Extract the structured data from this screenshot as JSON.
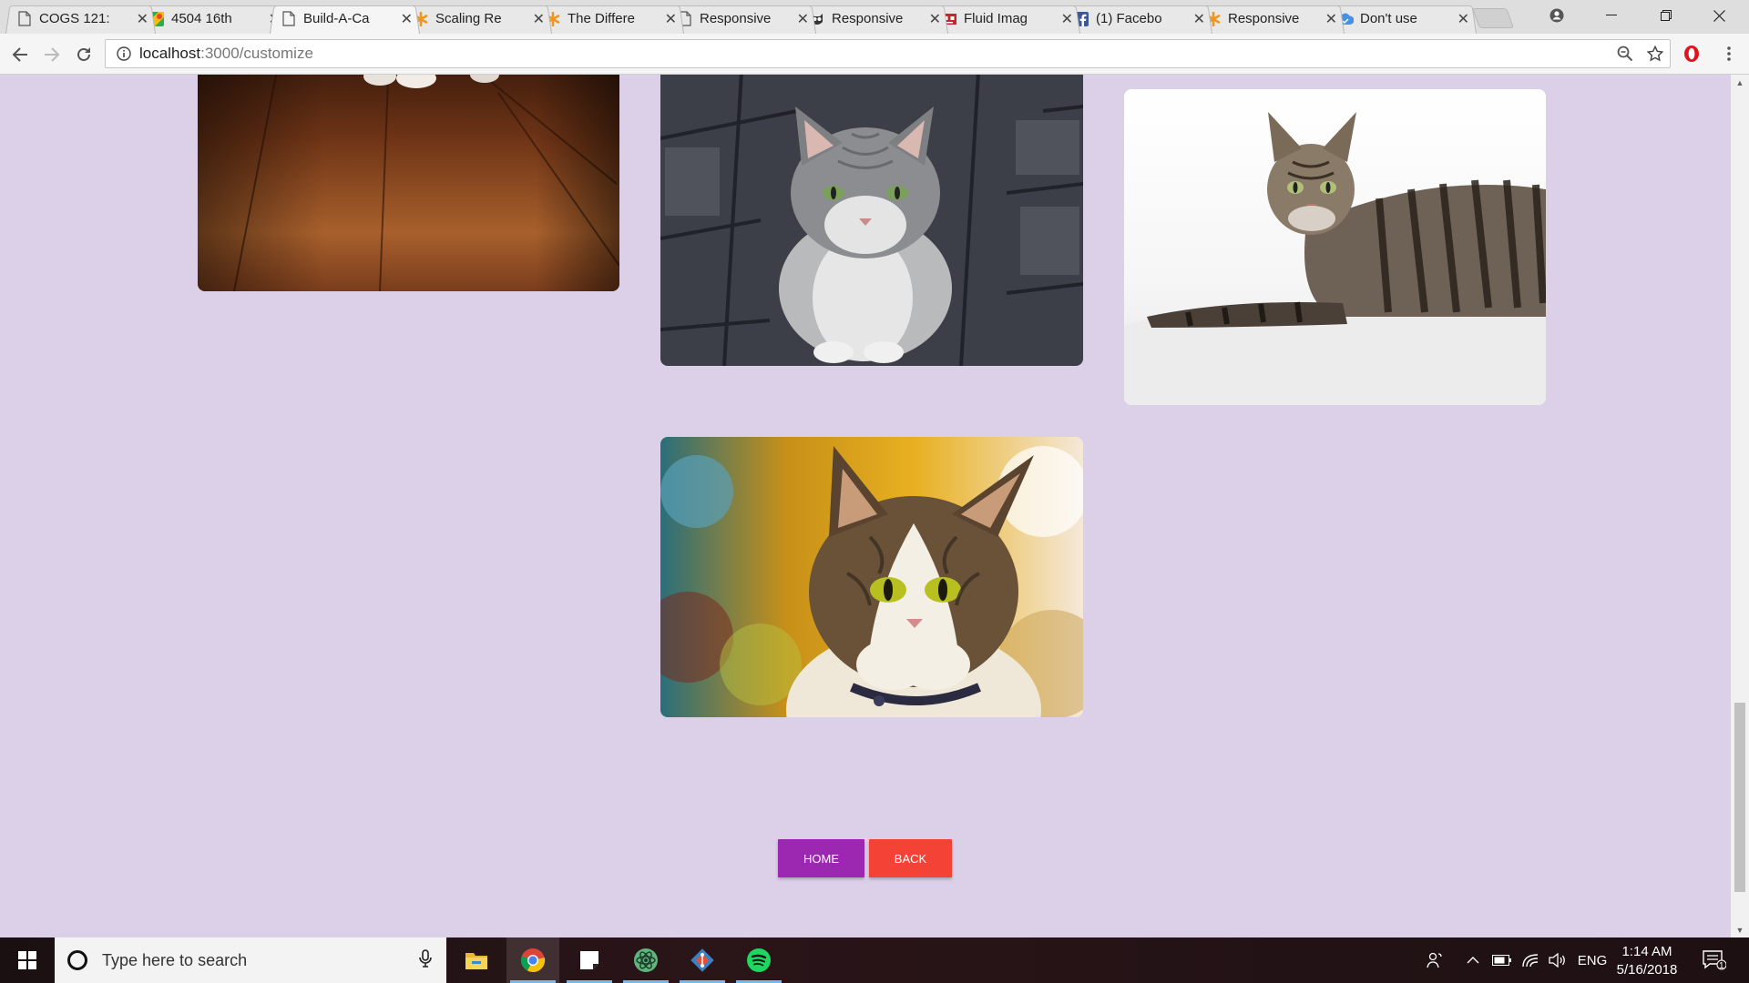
{
  "browser": {
    "tabs": [
      {
        "title": "COGS 121:",
        "icon": "page-icon"
      },
      {
        "title": "4504 16th",
        "icon": "maps-icon"
      },
      {
        "title": "Build-A-Ca",
        "icon": "page-icon",
        "active": true
      },
      {
        "title": "Scaling Re",
        "icon": "asterisk-icon"
      },
      {
        "title": "The Differe",
        "icon": "asterisk-icon"
      },
      {
        "title": "Responsive",
        "icon": "page-icon"
      },
      {
        "title": "Responsive",
        "icon": "owl-icon"
      },
      {
        "title": "Fluid Imag",
        "icon": "robot-icon"
      },
      {
        "title": "(1) Facebo",
        "icon": "facebook-icon"
      },
      {
        "title": "Responsive",
        "icon": "asterisk-icon"
      },
      {
        "title": "Don't use",
        "icon": "cloud-icon"
      }
    ],
    "url_host": "localhost",
    "url_path": ":3000/customize"
  },
  "page": {
    "images": [
      {
        "subject": "cat on wooden floor",
        "colors": [
          "#7a3d1c",
          "#a8602c",
          "#3a1a0c"
        ]
      },
      {
        "subject": "grey tabby cat sitting on stone pavement",
        "colors": [
          "#3c3f47",
          "#8b8d90",
          "#d8d8d8"
        ]
      },
      {
        "subject": "tabby cat lying on white blanket",
        "colors": [
          "#f4f4f4",
          "#4a4038",
          "#8a7a68"
        ]
      },
      {
        "subject": "tabby and white cat portrait",
        "colors": [
          "#c89018",
          "#f0ead8",
          "#3a2e20"
        ]
      }
    ],
    "buttons": {
      "home": "HOME",
      "back": "BACK"
    }
  },
  "taskbar": {
    "search_placeholder": "Type here to search",
    "apps": [
      "file-explorer-icon",
      "chrome-icon",
      "sticky-notes-icon",
      "atom-icon",
      "git-icon",
      "spotify-icon"
    ],
    "language": "ENG",
    "time": "1:14 AM",
    "date": "5/16/2018",
    "notification_count": "1"
  },
  "colors": {
    "page_background": "#dcd0e9",
    "home_button": "#9c27b0",
    "back_button": "#f44336"
  }
}
